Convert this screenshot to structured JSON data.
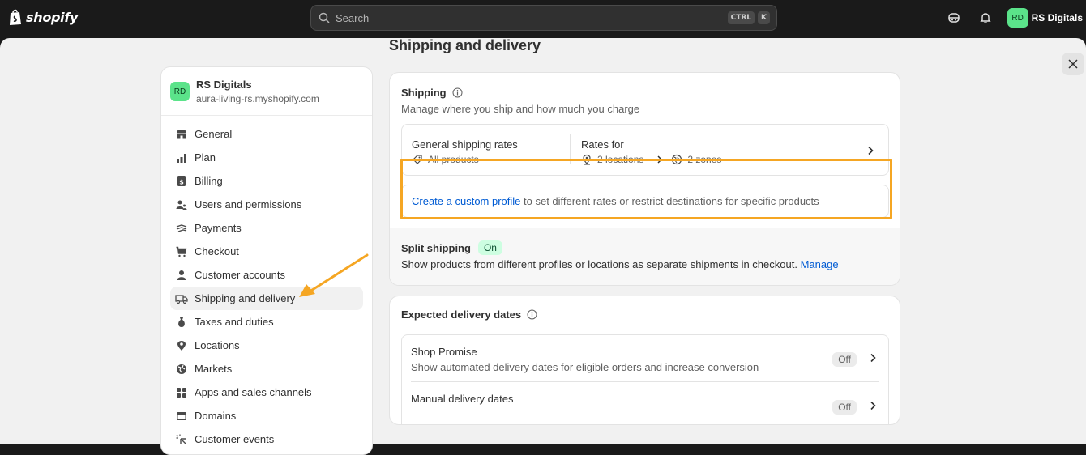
{
  "topbar": {
    "logo_text": "shopify",
    "search_placeholder": "Search",
    "shortcut_key1": "CTRL",
    "shortcut_key2": "K",
    "avatar_initials": "RD",
    "store_name": "RS Digitals"
  },
  "sidebar": {
    "store_initials": "RD",
    "store_name": "RS Digitals",
    "store_domain": "aura-living-rs.myshopify.com",
    "items": [
      {
        "label": "General",
        "icon": "store-icon"
      },
      {
        "label": "Plan",
        "icon": "plan-icon"
      },
      {
        "label": "Billing",
        "icon": "billing-icon"
      },
      {
        "label": "Users and permissions",
        "icon": "users-icon"
      },
      {
        "label": "Payments",
        "icon": "payments-icon"
      },
      {
        "label": "Checkout",
        "icon": "cart-icon"
      },
      {
        "label": "Customer accounts",
        "icon": "person-icon"
      },
      {
        "label": "Shipping and delivery",
        "icon": "truck-icon",
        "active": true
      },
      {
        "label": "Taxes and duties",
        "icon": "taxes-icon"
      },
      {
        "label": "Locations",
        "icon": "location-icon"
      },
      {
        "label": "Markets",
        "icon": "globe-icon"
      },
      {
        "label": "Apps and sales channels",
        "icon": "apps-icon"
      },
      {
        "label": "Domains",
        "icon": "domains-icon"
      },
      {
        "label": "Customer events",
        "icon": "events-icon"
      }
    ]
  },
  "main": {
    "page_title": "Shipping and delivery",
    "shipping": {
      "title": "Shipping",
      "subtitle": "Manage where you ship and how much you charge",
      "rates_title": "General shipping rates",
      "rates_products": "All products",
      "rates_for": "Rates for",
      "locations": "2 locations",
      "zones": "2 zones",
      "custom_link": "Create a custom profile",
      "custom_text": " to set different rates or restrict destinations for specific products",
      "split_title": "Split shipping",
      "split_badge": "On",
      "split_text": "Show products from different profiles or locations as separate shipments in checkout.",
      "split_link": "Manage"
    },
    "delivery": {
      "title": "Expected delivery dates",
      "rows": [
        {
          "title": "Shop Promise",
          "subtitle": "Show automated delivery dates for eligible orders and increase conversion",
          "status": "Off"
        },
        {
          "title": "Manual delivery dates",
          "subtitle": "",
          "status": "Off"
        }
      ]
    }
  },
  "colors": {
    "highlight": "#f5a623",
    "link": "#005bd3",
    "avatar": "#5be38a"
  }
}
